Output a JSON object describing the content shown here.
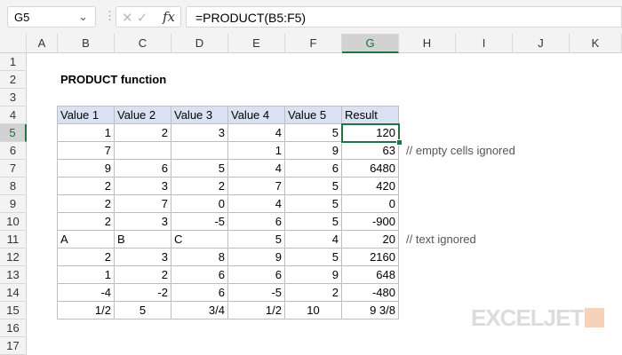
{
  "name_box": "G5",
  "formula": "=PRODUCT(B5:F5)",
  "columns": [
    "A",
    "B",
    "C",
    "D",
    "E",
    "F",
    "G",
    "H",
    "I",
    "J",
    "K"
  ],
  "rows": [
    "1",
    "2",
    "3",
    "4",
    "5",
    "6",
    "7",
    "8",
    "9",
    "10",
    "11",
    "12",
    "13",
    "14",
    "15",
    "16",
    "17"
  ],
  "title": "PRODUCT function",
  "headers": [
    "Value 1",
    "Value 2",
    "Value 3",
    "Value 4",
    "Value 5",
    "Result"
  ],
  "data": [
    [
      "1",
      "2",
      "3",
      "4",
      "5",
      "120"
    ],
    [
      "7",
      "",
      "",
      "1",
      "9",
      "63"
    ],
    [
      "9",
      "6",
      "5",
      "4",
      "6",
      "6480"
    ],
    [
      "2",
      "3",
      "2",
      "7",
      "5",
      "420"
    ],
    [
      "2",
      "7",
      "0",
      "4",
      "5",
      "0"
    ],
    [
      "2",
      "3",
      "-5",
      "6",
      "5",
      "-900"
    ],
    [
      "A",
      "B",
      "C",
      "5",
      "4",
      "20"
    ],
    [
      "2",
      "3",
      "8",
      "9",
      "5",
      "2160"
    ],
    [
      "1",
      "2",
      "6",
      "6",
      "9",
      "648"
    ],
    [
      "-4",
      "-2",
      "6",
      "-5",
      "2",
      "-480"
    ],
    [
      "1/2",
      "5",
      "3/4",
      "1/2",
      "10",
      "9 3/8"
    ]
  ],
  "notes": {
    "row6": "// empty cells ignored",
    "row11": "// text ignored"
  },
  "logo": "EXCELJET",
  "accent": "#217346"
}
